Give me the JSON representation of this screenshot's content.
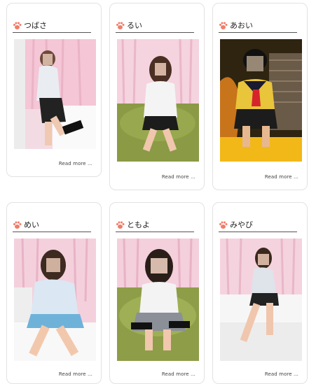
{
  "cards": [
    {
      "name": "つばさ",
      "read_more": "Read more ..."
    },
    {
      "name": "るい",
      "read_more": "Read more ..."
    },
    {
      "name": "あおい",
      "read_more": "Read more ..."
    },
    {
      "name": "めい",
      "read_more": "Read more ..."
    },
    {
      "name": "ともよ",
      "read_more": "Read more ..."
    },
    {
      "name": "みやび",
      "read_more": "Read more ..."
    }
  ],
  "colors": {
    "paw": "#f07d6a",
    "card_border": "#e2e2e2",
    "underline": "#555555"
  },
  "icons": [
    "paw-icon"
  ]
}
